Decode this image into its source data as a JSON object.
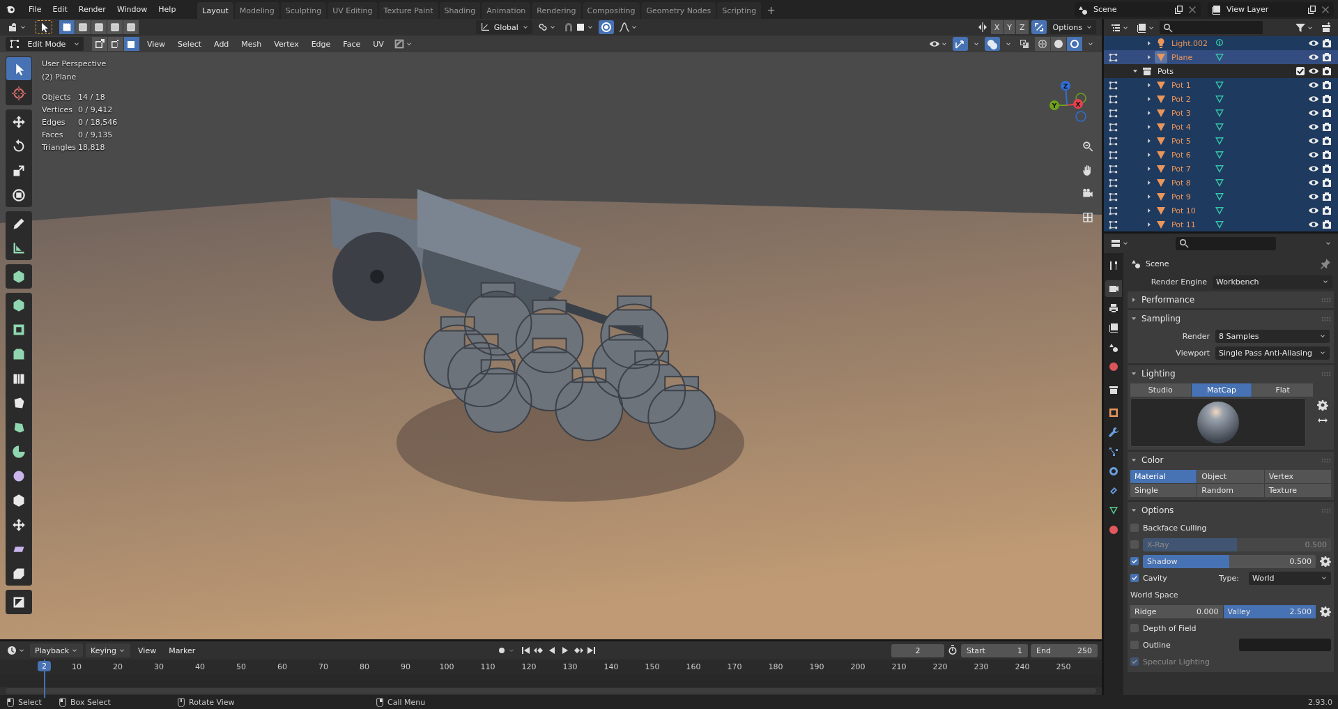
{
  "topbar": {
    "menus": [
      "File",
      "Edit",
      "Render",
      "Window",
      "Help"
    ],
    "workspaces": [
      {
        "label": "Layout",
        "selected": true
      },
      {
        "label": "Modeling",
        "selected": false
      },
      {
        "label": "Sculpting",
        "selected": false
      },
      {
        "label": "UV Editing",
        "selected": false
      },
      {
        "label": "Texture Paint",
        "selected": false
      },
      {
        "label": "Shading",
        "selected": false
      },
      {
        "label": "Animation",
        "selected": false
      },
      {
        "label": "Rendering",
        "selected": false
      },
      {
        "label": "Compositing",
        "selected": false
      },
      {
        "label": "Geometry Nodes",
        "selected": false
      },
      {
        "label": "Scripting",
        "selected": false
      }
    ],
    "add_tab": "+",
    "scene": "Scene",
    "view_layer": "View Layer"
  },
  "tool_header": {
    "select_box_modes": [
      {
        "selected": true
      },
      {
        "selected": false
      },
      {
        "selected": false
      },
      {
        "selected": false
      },
      {
        "selected": false
      }
    ],
    "orientation": "Global",
    "axes": [
      "X",
      "Y",
      "Z"
    ],
    "options": "Options"
  },
  "editor_header": {
    "mode": "Edit Mode",
    "select_modes": [
      {
        "kind": "vertex",
        "selected": false
      },
      {
        "kind": "edge",
        "selected": false
      },
      {
        "kind": "face",
        "selected": true
      }
    ],
    "menus": [
      "View",
      "Select",
      "Add",
      "Mesh",
      "Vertex",
      "Edge",
      "Face",
      "UV"
    ],
    "shading": [
      {
        "kind": "wireframe",
        "selected": false
      },
      {
        "kind": "solid",
        "selected": false
      },
      {
        "kind": "material",
        "selected": true
      }
    ]
  },
  "viewport": {
    "view_name": "User Perspective",
    "object_name": "(2) Plane",
    "stats": [
      {
        "label": "Objects",
        "value": "14 / 18"
      },
      {
        "label": "Vertices",
        "value": "0 / 9,412"
      },
      {
        "label": "Edges",
        "value": "0 / 18,546"
      },
      {
        "label": "Faces",
        "value": "0 / 9,135"
      },
      {
        "label": "Triangles",
        "value": "18,818"
      }
    ],
    "tool_groups": [
      [
        {
          "kind": "select",
          "selected": true
        },
        {
          "kind": "cursor",
          "selected": false
        }
      ],
      [
        {
          "kind": "move",
          "selected": false
        },
        {
          "kind": "rotate",
          "selected": false
        },
        {
          "kind": "scale",
          "selected": false
        },
        {
          "kind": "transform",
          "selected": false
        }
      ],
      [
        {
          "kind": "annotate",
          "selected": false
        },
        {
          "kind": "measure",
          "selected": false
        }
      ],
      [
        {
          "kind": "add-cube",
          "selected": false
        }
      ],
      [
        {
          "kind": "extrude",
          "selected": false
        },
        {
          "kind": "inset",
          "selected": false
        },
        {
          "kind": "bevel",
          "selected": false
        },
        {
          "kind": "loop-cut",
          "selected": false
        },
        {
          "kind": "knife",
          "selected": false
        },
        {
          "kind": "poly-build",
          "selected": false
        },
        {
          "kind": "spin",
          "selected": false
        },
        {
          "kind": "smooth",
          "selected": false
        },
        {
          "kind": "edge-slide",
          "selected": false
        },
        {
          "kind": "shrink",
          "selected": false
        },
        {
          "kind": "shear",
          "selected": false
        },
        {
          "kind": "rip",
          "selected": false
        }
      ],
      [
        {
          "kind": "toggle",
          "selected": false
        }
      ]
    ],
    "gizmo_axes": [
      {
        "label": "Z",
        "color": "#2e6fd8"
      },
      {
        "label": "Y",
        "color": "#6ea21b"
      },
      {
        "label": "X",
        "color": "#e5414f"
      }
    ]
  },
  "outliner": {
    "items": [
      {
        "label": "Light.002",
        "kind": "light",
        "selected": true,
        "active": false,
        "expanded": false
      },
      {
        "label": "Plane",
        "kind": "mesh",
        "selected": true,
        "active": true,
        "expanded": false
      },
      {
        "label": "Pots",
        "kind": "collection",
        "selected": false,
        "active": false,
        "expanded": true,
        "checked": true,
        "children": [
          {
            "label": "Pot 1",
            "kind": "mesh",
            "selected": true,
            "active": false,
            "expanded": false
          },
          {
            "label": "Pot 2",
            "kind": "mesh",
            "selected": true,
            "active": false,
            "expanded": false
          },
          {
            "label": "Pot 3",
            "kind": "mesh",
            "selected": true,
            "active": false,
            "expanded": false
          },
          {
            "label": "Pot 4",
            "kind": "mesh",
            "selected": true,
            "active": false,
            "expanded": false
          },
          {
            "label": "Pot 5",
            "kind": "mesh",
            "selected": true,
            "active": false,
            "expanded": false
          },
          {
            "label": "Pot 6",
            "kind": "mesh",
            "selected": true,
            "active": false,
            "expanded": false
          },
          {
            "label": "Pot 7",
            "kind": "mesh",
            "selected": true,
            "active": false,
            "expanded": false
          },
          {
            "label": "Pot 8",
            "kind": "mesh",
            "selected": true,
            "active": false,
            "expanded": false
          },
          {
            "label": "Pot 9",
            "kind": "mesh",
            "selected": true,
            "active": false,
            "expanded": false
          },
          {
            "label": "Pot 10",
            "kind": "mesh",
            "selected": true,
            "active": false,
            "expanded": false
          },
          {
            "label": "Pot 11",
            "kind": "mesh",
            "selected": true,
            "active": false,
            "expanded": false
          }
        ]
      }
    ]
  },
  "properties": {
    "tabs": [
      {
        "kind": "tool",
        "selected": false
      },
      {
        "kind": "render",
        "selected": true
      },
      {
        "kind": "output",
        "selected": false
      },
      {
        "kind": "view-layer",
        "selected": false
      },
      {
        "kind": "scene",
        "selected": false
      },
      {
        "kind": "world",
        "selected": false
      },
      {
        "kind": "collection",
        "selected": false
      },
      {
        "kind": "object",
        "selected": false
      },
      {
        "kind": "modifiers",
        "selected": false
      },
      {
        "kind": "particles",
        "selected": false
      },
      {
        "kind": "physics",
        "selected": false
      },
      {
        "kind": "constraints",
        "selected": false
      },
      {
        "kind": "data",
        "selected": false
      },
      {
        "kind": "material",
        "selected": false
      }
    ],
    "context": "Scene",
    "render_engine_label": "Render Engine",
    "render_engine": "Workbench",
    "sections": [
      {
        "title": "Performance",
        "expanded": false
      },
      {
        "kind": "fields",
        "title": "Sampling",
        "expanded": true,
        "fields": [
          {
            "label": "Render",
            "value": "8 Samples"
          },
          {
            "label": "Viewport",
            "value": "Single Pass Anti-Aliasing"
          }
        ]
      },
      {
        "kind": "lighting",
        "title": "Lighting",
        "expanded": true,
        "modes": [
          {
            "label": "Studio",
            "selected": false
          },
          {
            "label": "MatCap",
            "selected": true
          },
          {
            "label": "Flat",
            "selected": false
          }
        ]
      },
      {
        "kind": "grid",
        "title": "Color",
        "expanded": true,
        "modes": [
          {
            "label": "Material",
            "selected": true
          },
          {
            "label": "Object",
            "selected": false
          },
          {
            "label": "Vertex",
            "selected": false
          },
          {
            "label": "Single",
            "selected": false
          },
          {
            "label": "Random",
            "selected": false
          },
          {
            "label": "Texture",
            "selected": false
          }
        ]
      },
      {
        "kind": "options",
        "title": "Options",
        "expanded": true,
        "rows": [
          {
            "kind": "check",
            "label": "Backface Culling",
            "checked": false,
            "disabled": false
          },
          {
            "kind": "check-slider",
            "label": "X-Ray",
            "checked": false,
            "level": 0.5,
            "value": "0.500",
            "disabled": true,
            "gear": false
          },
          {
            "kind": "check-slider",
            "label": "Shadow",
            "checked": true,
            "level": 0.5,
            "value": "0.500",
            "disabled": false,
            "gear": true
          },
          {
            "kind": "check-select",
            "label": "Cavity",
            "checked": true,
            "select_label": "Type:",
            "value": "World"
          },
          {
            "kind": "heading",
            "label": "World Space"
          },
          {
            "kind": "pair",
            "items": [
              {
                "label": "Ridge",
                "value": "0.000",
                "selected": false
              },
              {
                "label": "Valley",
                "value": "2.500",
                "selected": true
              }
            ],
            "gear": true
          },
          {
            "kind": "check",
            "label": "Depth of Field",
            "checked": false,
            "disabled": false
          },
          {
            "kind": "check-swatch",
            "label": "Outline",
            "checked": false
          },
          {
            "kind": "check",
            "label": "Specular Lighting",
            "checked": true,
            "disabled": true
          }
        ]
      }
    ]
  },
  "timeline": {
    "menus": [
      {
        "label": "Playback",
        "dropdown": true
      },
      {
        "label": "Keying",
        "dropdown": true
      },
      {
        "label": "View",
        "dropdown": false
      },
      {
        "label": "Marker",
        "dropdown": false
      }
    ],
    "frame": "2",
    "start_label": "Start",
    "start": "1",
    "end_label": "End",
    "end": "250",
    "current": "2",
    "ticks": [
      "10",
      "20",
      "30",
      "40",
      "50",
      "60",
      "70",
      "80",
      "90",
      "100",
      "110",
      "120",
      "130",
      "140",
      "150",
      "160",
      "170",
      "180",
      "190",
      "200",
      "210",
      "220",
      "230",
      "240",
      "250"
    ]
  },
  "status_bar": {
    "hints": [
      {
        "kind": "left",
        "label": "Select"
      },
      {
        "kind": "drag",
        "label": "Box Select"
      },
      {
        "kind": "middle",
        "label": "Rotate View"
      },
      {
        "kind": "right",
        "label": "Call Menu"
      }
    ],
    "version": "2.93.0"
  }
}
